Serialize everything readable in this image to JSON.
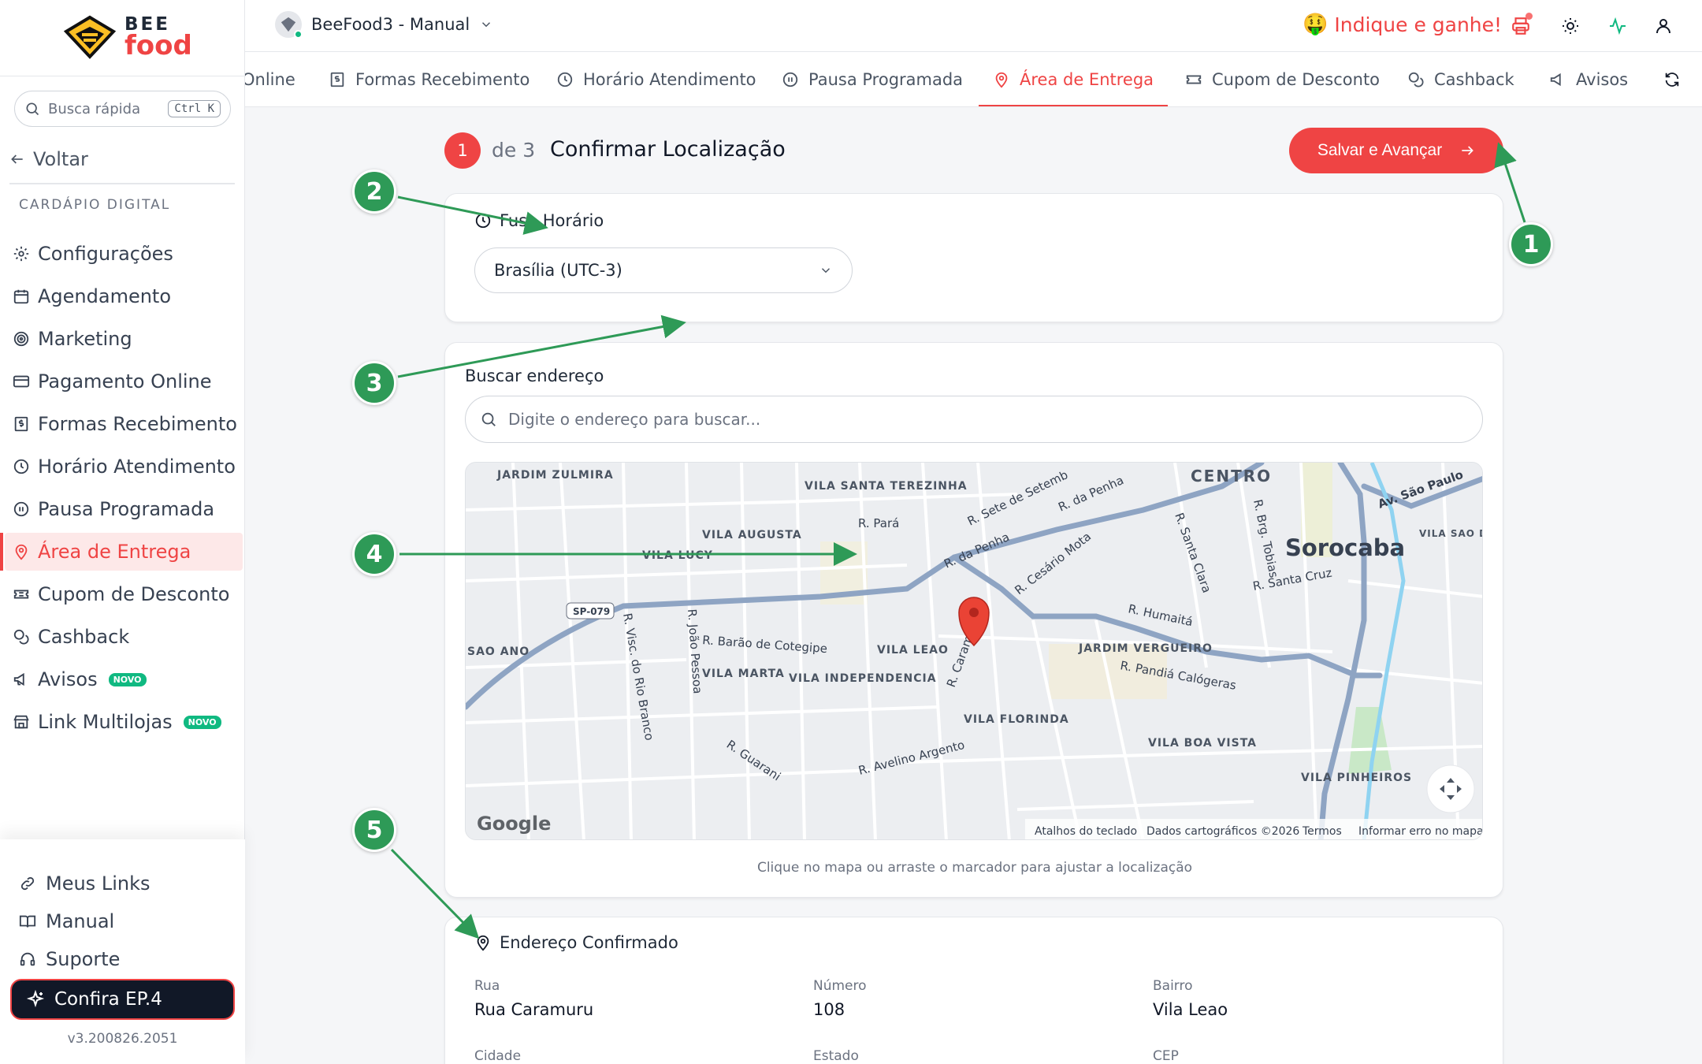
{
  "brand": {
    "top": "BEE",
    "bottom": "food",
    "accent": "#ef4444"
  },
  "sidebar": {
    "search_placeholder": "Busca rápida",
    "shortcut": "Ctrl K",
    "back_label": "Voltar",
    "section_label": "CARDÁPIO DIGITAL",
    "items": [
      {
        "label": "Configurações",
        "icon": "gear-icon"
      },
      {
        "label": "Agendamento",
        "icon": "calendar-icon"
      },
      {
        "label": "Marketing",
        "icon": "target-icon"
      },
      {
        "label": "Pagamento Online",
        "icon": "credit-card-icon"
      },
      {
        "label": "Formas Recebimento",
        "icon": "receipt-icon"
      },
      {
        "label": "Horário Atendimento",
        "icon": "clock-icon"
      },
      {
        "label": "Pausa Programada",
        "icon": "pause-icon"
      },
      {
        "label": "Área de Entrega",
        "icon": "map-pin-icon",
        "active": true
      },
      {
        "label": "Cupom de Desconto",
        "icon": "ticket-icon"
      },
      {
        "label": "Cashback",
        "icon": "coins-icon"
      },
      {
        "label": "Avisos",
        "icon": "megaphone-icon",
        "badge": "NOVO"
      },
      {
        "label": "Link Multilojas",
        "icon": "store-icon",
        "badge": "NOVO"
      }
    ],
    "bottom": {
      "links": "Meus Links",
      "manual": "Manual",
      "support": "Suporte",
      "promo": "Confira EP.4",
      "version": "v3.200826.2051"
    }
  },
  "topbar": {
    "store_name": "BeeFood3 - Manual",
    "refer_label": "Indique e ganhe!"
  },
  "tabs": [
    {
      "label": "Online"
    },
    {
      "label": "Formas Recebimento"
    },
    {
      "label": "Horário Atendimento"
    },
    {
      "label": "Pausa Programada"
    },
    {
      "label": "Área de Entrega",
      "active": true
    },
    {
      "label": "Cupom de Desconto"
    },
    {
      "label": "Cashback"
    },
    {
      "label": "Avisos"
    }
  ],
  "step": {
    "current": "1",
    "of": "de 3",
    "title": "Confirmar Localização",
    "save_label": "Salvar e Avançar"
  },
  "timezone": {
    "label": "Fuso Horário",
    "value": "Brasília (UTC-3)"
  },
  "address_search": {
    "label": "Buscar endereço",
    "placeholder": "Digite o endereço para buscar..."
  },
  "map": {
    "labels": {
      "centro": "CENTRO",
      "city": "Sorocaba",
      "jardim_zulmira": "JARDIM ZULMIRA",
      "vila_santa_terezinha": "VILA SANTA TEREZINHA",
      "vila_augusta": "VILA AUGUSTA",
      "vila_lucy": "VILA LUCY",
      "vila_leao": "VILA LEAO",
      "vila_marta": "VILA MARTA",
      "vila_independencia": "VILA INDEPENDENCIA",
      "vila_florinda": "VILA FLORINDA",
      "jardim_vergueiro": "JARDIM VERGUEIRO",
      "vila_boa_vista": "VILA BOA VISTA",
      "vila_pinheiros": "VILA PINHEIROS",
      "vila_sao_domingos": "VILA SAO DOMINGOS",
      "sao_ano": "SAO ANO",
      "sp079": "SP-079",
      "r_sete": "R. Sete de Setemb",
      "r_penha": "R. da Penha",
      "r_para": "R. Pará",
      "r_cesario": "R. Cesário Mota",
      "r_santa_clara": "R. Santa Clara",
      "r_humaita": "R. Humaitá",
      "r_santa_cruz": "R. Santa Cruz",
      "r_pandia": "R. Pandiá Calógeras",
      "r_barao": "R. Barão de Cotegipe",
      "r_joao_pessoa": "R. João Pessoa",
      "r_visc_rio_branco": "R. Visc. do Rio Branco",
      "r_caramuru": "R. Caramuru",
      "r_avelino": "R. Avelino Argento",
      "r_guarani": "R. Guarani",
      "av_sao_paulo": "Av. São Paulo"
    },
    "google": "Google",
    "attrib_keyboard": "Atalhos do teclado",
    "attrib_data": "Dados cartográficos ©2026",
    "attrib_terms": "Termos",
    "attrib_report": "Informar erro no mapa",
    "hint": "Clique no mapa ou arraste o marcador para ajustar a localização"
  },
  "confirmed": {
    "title": "Endereço Confirmado",
    "street_label": "Rua",
    "street": "Rua Caramuru",
    "number_label": "Número",
    "number": "108",
    "district_label": "Bairro",
    "district": "Vila Leao",
    "city_label": "Cidade",
    "state_label": "Estado",
    "cep_label": "CEP"
  },
  "annotations": [
    "1",
    "2",
    "3",
    "4",
    "5"
  ],
  "colors": {
    "accent": "#ef4444",
    "annotation": "#2e9a57",
    "badge": "#10b981"
  }
}
